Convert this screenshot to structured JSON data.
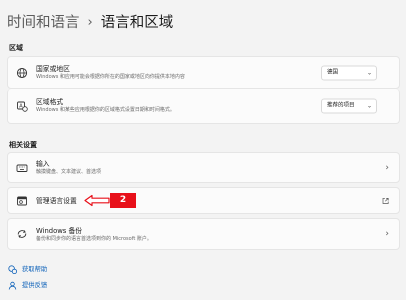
{
  "breadcrumb": {
    "parent": "时间和语言",
    "separator": "›",
    "current": "语言和区域"
  },
  "sections": {
    "region": "区域",
    "related": "相关设置"
  },
  "region": {
    "country": {
      "title": "国家或地区",
      "desc": "Windows 和应用可能会根据你所在的国家或地区向你提供本地内容",
      "value": "德国",
      "icon": "globe-icon"
    },
    "format": {
      "title": "区域格式",
      "desc": "Windows 和某些应用根据你的区域格式设置日期和时间格式。",
      "value": "推荐的项目",
      "icon": "region-format-icon"
    }
  },
  "related": {
    "input": {
      "title": "输入",
      "desc": "触摸键盘、文本建议、首选项",
      "icon": "keyboard-icon"
    },
    "admin_lang": {
      "title": "管理语言设置",
      "icon": "admin-language-icon"
    },
    "backup": {
      "title": "Windows 备份",
      "desc": "备份和同步你的语言首选项到你的 Microsoft 账户。",
      "icon": "backup-sync-icon"
    }
  },
  "annotation": {
    "badge": "2",
    "color": "#e8101a"
  },
  "links": {
    "help": "获取帮助",
    "feedback": "提供反馈"
  },
  "colors": {
    "accent": "#0a5fb8",
    "background": "#f3f3f3",
    "card": "#fbfbfb"
  }
}
